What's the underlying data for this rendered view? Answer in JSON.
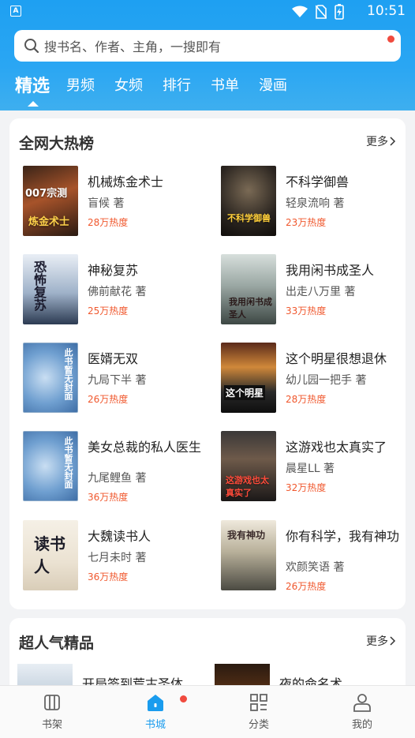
{
  "status_bar": {
    "app_badge": "A",
    "time": "10:51"
  },
  "search": {
    "placeholder": "搜书名、作者、主角，一搜即有"
  },
  "tabs": [
    {
      "label": "精选"
    },
    {
      "label": "男频"
    },
    {
      "label": "女频"
    },
    {
      "label": "排行"
    },
    {
      "label": "书单"
    },
    {
      "label": "漫画"
    }
  ],
  "hot_section": {
    "title": "全网大热榜",
    "more_label": "更多",
    "books": [
      {
        "title": "机械炼金术士",
        "author": "盲候 著",
        "heat": "28万热度",
        "cover_text": "007宗测 炼金术士"
      },
      {
        "title": "不科学御兽",
        "author": "轻泉流响 著",
        "heat": "23万热度",
        "cover_text": "不科学御兽"
      },
      {
        "title": "神秘复苏",
        "author": "佛前献花 著",
        "heat": "25万热度",
        "cover_text": "恐怖复苏"
      },
      {
        "title": "我用闲书成圣人",
        "author": "出走八万里 著",
        "heat": "33万热度",
        "cover_text": "我用闲书成圣人"
      },
      {
        "title": "医婿无双",
        "author": "九局下半 著",
        "heat": "26万热度",
        "cover_text": "此书暂无封面"
      },
      {
        "title": "这个明星很想退休",
        "author": "幼儿园一把手 著",
        "heat": "28万热度",
        "cover_text": "这个明星"
      },
      {
        "title": "美女总裁的私人医生",
        "author": "九尾鲤鱼 著",
        "heat": "36万热度",
        "cover_text": "此书暂无封面"
      },
      {
        "title": "这游戏也太真实了",
        "author": "晨星LL 著",
        "heat": "32万热度",
        "cover_text": "这游戏也太真实了"
      },
      {
        "title": "大魏读书人",
        "author": "七月未时 著",
        "heat": "36万热度",
        "cover_text": "读书人"
      },
      {
        "title": "你有科学，我有神功",
        "author": "欢颜笑语 著",
        "heat": "26万热度",
        "cover_text": "我有神功"
      }
    ]
  },
  "popular_section": {
    "title": "超人气精品",
    "more_label": "更多",
    "books": [
      {
        "title": "开局签到荒古圣体"
      },
      {
        "title": "夜的命名术"
      }
    ]
  },
  "bottom_nav": [
    {
      "label": "书架",
      "icon": "bookshelf-icon"
    },
    {
      "label": "书城",
      "icon": "store-icon"
    },
    {
      "label": "分类",
      "icon": "category-icon"
    },
    {
      "label": "我的",
      "icon": "profile-icon"
    }
  ],
  "colors": {
    "primary": "#1ea0f2",
    "heat": "#f0582e",
    "badge": "#f04a3e"
  }
}
